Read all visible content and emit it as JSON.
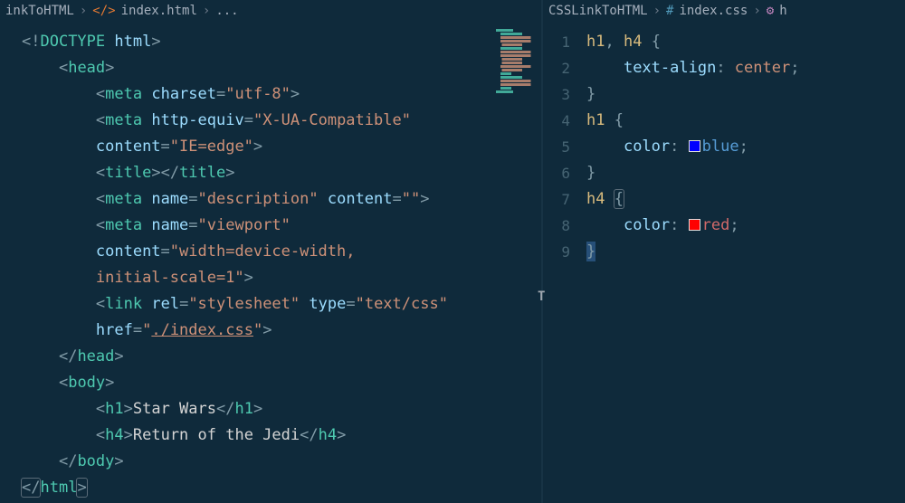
{
  "left": {
    "breadcrumb": {
      "folder": "inkToHTML",
      "file": "index.html",
      "more": "..."
    },
    "lines": [
      [
        {
          "t": "<!",
          "c": "c-punc"
        },
        {
          "t": "DOCTYPE",
          "c": "c-doctype"
        },
        {
          "t": " ",
          "c": "c-text"
        },
        {
          "t": "html",
          "c": "c-attr"
        },
        {
          "t": ">",
          "c": "c-punc"
        }
      ],
      [
        {
          "t": "    ",
          "c": "c-text"
        },
        {
          "t": "<",
          "c": "c-punc"
        },
        {
          "t": "head",
          "c": "c-tag"
        },
        {
          "t": ">",
          "c": "c-punc"
        }
      ],
      [
        {
          "t": "        ",
          "c": "c-text"
        },
        {
          "t": "<",
          "c": "c-punc"
        },
        {
          "t": "meta",
          "c": "c-tag"
        },
        {
          "t": " ",
          "c": "c-text"
        },
        {
          "t": "charset",
          "c": "c-attr"
        },
        {
          "t": "=",
          "c": "c-punc"
        },
        {
          "t": "\"utf-8\"",
          "c": "c-str"
        },
        {
          "t": ">",
          "c": "c-punc"
        }
      ],
      [
        {
          "t": "        ",
          "c": "c-text"
        },
        {
          "t": "<",
          "c": "c-punc"
        },
        {
          "t": "meta",
          "c": "c-tag"
        },
        {
          "t": " ",
          "c": "c-text"
        },
        {
          "t": "http-equiv",
          "c": "c-attr"
        },
        {
          "t": "=",
          "c": "c-punc"
        },
        {
          "t": "\"X-UA-Compatible\"",
          "c": "c-str"
        }
      ],
      [
        {
          "t": "        ",
          "c": "c-text"
        },
        {
          "t": "content",
          "c": "c-attr"
        },
        {
          "t": "=",
          "c": "c-punc"
        },
        {
          "t": "\"IE=edge\"",
          "c": "c-str"
        },
        {
          "t": ">",
          "c": "c-punc"
        }
      ],
      [
        {
          "t": "        ",
          "c": "c-text"
        },
        {
          "t": "<",
          "c": "c-punc"
        },
        {
          "t": "title",
          "c": "c-tag"
        },
        {
          "t": ">",
          "c": "c-punc"
        },
        {
          "t": "</",
          "c": "c-punc"
        },
        {
          "t": "title",
          "c": "c-tag"
        },
        {
          "t": ">",
          "c": "c-punc"
        }
      ],
      [
        {
          "t": "        ",
          "c": "c-text"
        },
        {
          "t": "<",
          "c": "c-punc"
        },
        {
          "t": "meta",
          "c": "c-tag"
        },
        {
          "t": " ",
          "c": "c-text"
        },
        {
          "t": "name",
          "c": "c-attr"
        },
        {
          "t": "=",
          "c": "c-punc"
        },
        {
          "t": "\"description\"",
          "c": "c-str"
        },
        {
          "t": " ",
          "c": "c-text"
        },
        {
          "t": "content",
          "c": "c-attr"
        },
        {
          "t": "=",
          "c": "c-punc"
        },
        {
          "t": "\"\"",
          "c": "c-str"
        },
        {
          "t": ">",
          "c": "c-punc"
        }
      ],
      [
        {
          "t": "        ",
          "c": "c-text"
        },
        {
          "t": "<",
          "c": "c-punc"
        },
        {
          "t": "meta",
          "c": "c-tag"
        },
        {
          "t": " ",
          "c": "c-text"
        },
        {
          "t": "name",
          "c": "c-attr"
        },
        {
          "t": "=",
          "c": "c-punc"
        },
        {
          "t": "\"viewport\"",
          "c": "c-str"
        }
      ],
      [
        {
          "t": "        ",
          "c": "c-text"
        },
        {
          "t": "content",
          "c": "c-attr"
        },
        {
          "t": "=",
          "c": "c-punc"
        },
        {
          "t": "\"width=device-width,",
          "c": "c-str"
        }
      ],
      [
        {
          "t": "        ",
          "c": "c-text"
        },
        {
          "t": "initial-scale=1\"",
          "c": "c-str"
        },
        {
          "t": ">",
          "c": "c-punc"
        }
      ],
      [
        {
          "t": "        ",
          "c": "c-text"
        },
        {
          "t": "<",
          "c": "c-punc"
        },
        {
          "t": "link",
          "c": "c-tag"
        },
        {
          "t": " ",
          "c": "c-text"
        },
        {
          "t": "rel",
          "c": "c-attr"
        },
        {
          "t": "=",
          "c": "c-punc"
        },
        {
          "t": "\"stylesheet\"",
          "c": "c-str"
        },
        {
          "t": " ",
          "c": "c-text"
        },
        {
          "t": "type",
          "c": "c-attr"
        },
        {
          "t": "=",
          "c": "c-punc"
        },
        {
          "t": "\"text/css\"",
          "c": "c-str"
        }
      ],
      [
        {
          "t": "        ",
          "c": "c-text"
        },
        {
          "t": "href",
          "c": "c-attr"
        },
        {
          "t": "=",
          "c": "c-punc"
        },
        {
          "t": "\"",
          "c": "c-str"
        },
        {
          "t": "./index.css",
          "c": "c-link"
        },
        {
          "t": "\"",
          "c": "c-str"
        },
        {
          "t": ">",
          "c": "c-punc"
        }
      ],
      [
        {
          "t": "    ",
          "c": "c-text"
        },
        {
          "t": "</",
          "c": "c-punc"
        },
        {
          "t": "head",
          "c": "c-tag"
        },
        {
          "t": ">",
          "c": "c-punc"
        }
      ],
      [
        {
          "t": "    ",
          "c": "c-text"
        },
        {
          "t": "<",
          "c": "c-punc"
        },
        {
          "t": "body",
          "c": "c-tag"
        },
        {
          "t": ">",
          "c": "c-punc"
        }
      ],
      [
        {
          "t": "        ",
          "c": "c-text"
        },
        {
          "t": "<",
          "c": "c-punc"
        },
        {
          "t": "h1",
          "c": "c-tag"
        },
        {
          "t": ">",
          "c": "c-punc"
        },
        {
          "t": "Star Wars",
          "c": "c-text"
        },
        {
          "t": "</",
          "c": "c-punc"
        },
        {
          "t": "h1",
          "c": "c-tag"
        },
        {
          "t": ">",
          "c": "c-punc"
        }
      ],
      [
        {
          "t": "        ",
          "c": "c-text"
        },
        {
          "t": "<",
          "c": "c-punc"
        },
        {
          "t": "h4",
          "c": "c-tag"
        },
        {
          "t": ">",
          "c": "c-punc"
        },
        {
          "t": "Return of the Jedi",
          "c": "c-text"
        },
        {
          "t": "</",
          "c": "c-punc"
        },
        {
          "t": "h4",
          "c": "c-tag"
        },
        {
          "t": ">",
          "c": "c-punc"
        }
      ],
      [
        {
          "t": "    ",
          "c": "c-text"
        },
        {
          "t": "</",
          "c": "c-punc"
        },
        {
          "t": "body",
          "c": "c-tag"
        },
        {
          "t": ">",
          "c": "c-punc"
        }
      ],
      [
        {
          "t": "</",
          "c": "c-punc hl-box"
        },
        {
          "t": "html",
          "c": "c-tag"
        },
        {
          "t": ">",
          "c": "c-punc hl-box"
        }
      ]
    ]
  },
  "right": {
    "breadcrumb": {
      "folder": "CSSLinkToHTML",
      "file": "index.css",
      "symbol": "h"
    },
    "lineNumbers": [
      "1",
      "2",
      "3",
      "4",
      "5",
      "6",
      "7",
      "8",
      "9"
    ],
    "lines": [
      [
        {
          "t": "h1",
          "c": "c-sel"
        },
        {
          "t": ", ",
          "c": "c-punc"
        },
        {
          "t": "h4",
          "c": "c-sel"
        },
        {
          "t": " {",
          "c": "c-punc"
        }
      ],
      [
        {
          "t": "    ",
          "c": "c-text"
        },
        {
          "t": "text-align",
          "c": "c-prop"
        },
        {
          "t": ": ",
          "c": "c-punc"
        },
        {
          "t": "center",
          "c": "c-val"
        },
        {
          "t": ";",
          "c": "c-punc"
        }
      ],
      [
        {
          "t": "}",
          "c": "c-punc"
        }
      ],
      [
        {
          "t": "h1",
          "c": "c-sel"
        },
        {
          "t": " {",
          "c": "c-punc"
        }
      ],
      [
        {
          "t": "    ",
          "c": "c-text"
        },
        {
          "t": "color",
          "c": "c-prop"
        },
        {
          "t": ": ",
          "c": "c-punc"
        },
        {
          "swatch": "blue"
        },
        {
          "t": "blue",
          "c": "c-blue"
        },
        {
          "t": ";",
          "c": "c-punc"
        }
      ],
      [
        {
          "t": "}",
          "c": "c-punc"
        }
      ],
      [
        {
          "t": "h4",
          "c": "c-sel"
        },
        {
          "t": " ",
          "c": "c-text"
        },
        {
          "t": "{",
          "c": "c-punc hl-box"
        }
      ],
      [
        {
          "t": "    ",
          "c": "c-text"
        },
        {
          "t": "color",
          "c": "c-prop"
        },
        {
          "t": ": ",
          "c": "c-punc"
        },
        {
          "swatch": "red"
        },
        {
          "t": "red",
          "c": "c-red"
        },
        {
          "t": ";",
          "c": "c-punc"
        }
      ],
      [
        {
          "t": "}",
          "c": "c-punc sel-block"
        }
      ]
    ]
  }
}
